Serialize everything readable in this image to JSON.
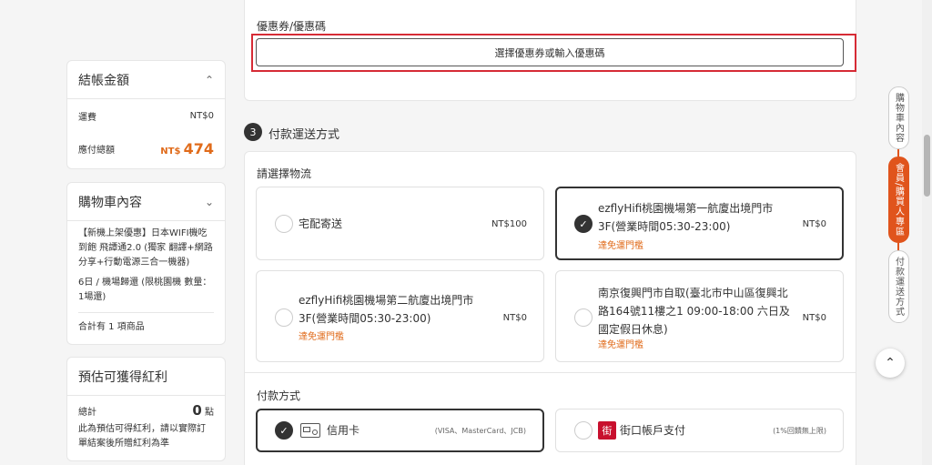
{
  "summary": {
    "title": "結帳金額",
    "shipping_label": "運費",
    "shipping_value": "NT$0",
    "total_label": "應付總額",
    "total_currency": "NT$",
    "total_value": "474"
  },
  "cart": {
    "title": "購物車內容",
    "product_name": "【新機上架優惠】日本WIFI機吃到飽 飛譚通2.0 (獨家 翻譯+網路分享+行動電源三合一機器)",
    "product_detail": "6日 / 機場歸還 (限桃園機 數量：1場還)",
    "count_text": "合計有 1 項商品"
  },
  "bonus": {
    "title": "預估可獲得紅利",
    "total_label": "總計",
    "points_value": "0",
    "points_unit": "點",
    "note": "此為預估可得紅利，請以實際訂單結案後所贈紅利為準"
  },
  "coupon": {
    "label": "優惠券/優惠碼",
    "button_label": "選擇優惠券或輸入優惠碼"
  },
  "step3": {
    "number": "3",
    "title": "付款運送方式"
  },
  "logistics": {
    "label": "請選擇物流",
    "options": [
      {
        "name": "宅配寄送",
        "price": "NT$100",
        "note": ""
      },
      {
        "name": "ezflyHifi桃園機場第一航廈出境門市3F(營業時間05:30-23:00)",
        "price": "NT$0",
        "note": "達免運門檻"
      },
      {
        "name": "ezflyHifi桃園機場第二航廈出境門市3F(營業時間05:30-23:00)",
        "price": "NT$0",
        "note": "達免運門檻"
      },
      {
        "name": "南京復興門市自取(臺北市中山區復興北路164號11樓之1 09:00-18:00 六日及國定假日休息)",
        "price": "NT$0",
        "note": "達免運門檻"
      }
    ]
  },
  "payment": {
    "label": "付款方式",
    "options": [
      {
        "name": "信用卡",
        "note": "(VISA、MasterCard、JCB)",
        "icon": "credit-card-icon"
      },
      {
        "name": "街口帳戶支付",
        "note": "(1%回饋無上限)",
        "icon": "jko-pay-icon",
        "icon_glyph": "街"
      }
    ]
  },
  "rail": {
    "items": [
      "購物車內容",
      "會員/購買人專區",
      "付款運送方式"
    ]
  },
  "colors": {
    "accent": "#e0541c",
    "highlight_border": "#d62b35",
    "price_orange": "#e06b1b"
  }
}
